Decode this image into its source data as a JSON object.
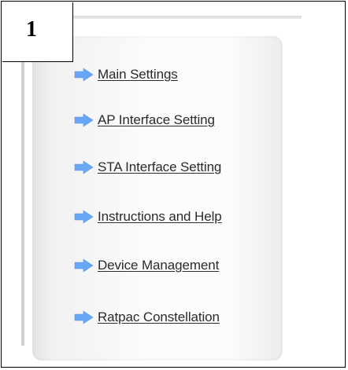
{
  "step": {
    "number": "1"
  },
  "menu": {
    "items": [
      {
        "label": "Main Settings",
        "icon": "arrow-right-icon"
      },
      {
        "label": "AP Interface Setting",
        "icon": "arrow-right-icon"
      },
      {
        "label": "STA Interface Setting",
        "icon": "arrow-right-icon"
      },
      {
        "label": "Instructions and Help",
        "icon": "arrow-right-icon"
      },
      {
        "label": "Device Management",
        "icon": "arrow-right-icon"
      },
      {
        "label": "Ratpac Constellation",
        "icon": "arrow-right-icon"
      }
    ]
  },
  "colors": {
    "arrow": "#68a7f4",
    "text": "#2b2b2b",
    "panel": "#f6f6f6"
  }
}
